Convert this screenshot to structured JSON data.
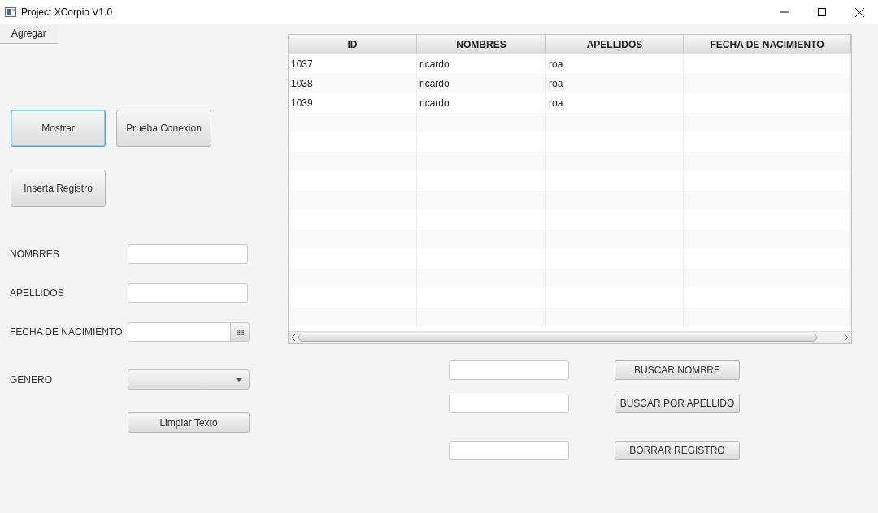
{
  "window": {
    "title": "Project XCorpio V1.0"
  },
  "menu": [
    {
      "label": "Agregar"
    }
  ],
  "actions": [
    {
      "label": "Mostrar",
      "focused": true
    },
    {
      "label": "Prueba Conexion",
      "focused": false
    },
    {
      "label": "Inserta Registro",
      "focused": false
    }
  ],
  "form": [
    {
      "label": "NOMBRES",
      "kind": "text"
    },
    {
      "label": "APELLIDOS",
      "kind": "text"
    },
    {
      "label": "FECHA DE NACIMIENTO",
      "kind": "date"
    },
    {
      "label": "GENERO",
      "kind": "combo"
    }
  ],
  "clear_button": "Limpiar Texto",
  "table": {
    "columns": [
      "ID",
      "NOMBRES",
      "APELLIDOS",
      "FECHA DE NACIMIENTO"
    ],
    "rows": [
      [
        "1037",
        "ricardo",
        "roa",
        ""
      ],
      [
        "1038",
        "ricardo",
        "roa",
        ""
      ],
      [
        "1039",
        "ricardo",
        "roa",
        ""
      ]
    ]
  },
  "search": [
    {
      "button": "BUSCAR NOMBRE"
    },
    {
      "button": "BUSCAR POR APELLIDO"
    },
    {
      "button": "BORRAR REGISTRO"
    }
  ]
}
